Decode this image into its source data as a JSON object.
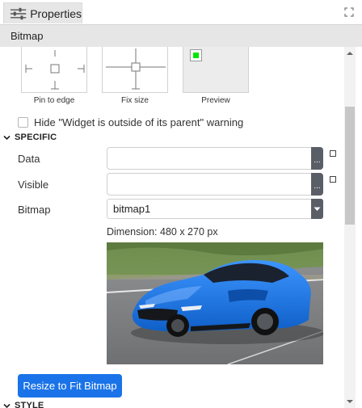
{
  "panel": {
    "tab_title": "Properties",
    "section_title": "Bitmap"
  },
  "anchors": {
    "pin_to_edge": "Pin to edge",
    "fix_size": "Fix size",
    "preview": "Preview",
    "preview_swatch_color": "#00e600"
  },
  "warning_option": {
    "label": "Hide \"Widget is outside of its parent\" warning",
    "checked": false
  },
  "specific": {
    "header": "SPECIFIC",
    "data": {
      "label": "Data",
      "value": "",
      "button": "..."
    },
    "visible": {
      "label": "Visible",
      "value": "",
      "button": "..."
    },
    "bitmap": {
      "label": "Bitmap",
      "selected": "bitmap1"
    },
    "dimension": "Dimension: 480 x 270 px",
    "resize_button": "Resize to Fit Bitmap"
  },
  "style": {
    "header": "STYLE"
  },
  "colors": {
    "accent": "#1a73e8",
    "header_bg": "#e6e6e6",
    "picker_button": "#5a5e66",
    "car_body": "#1f78e6"
  },
  "icons": {
    "tab": "sliders-icon",
    "maximize": "maximize-icon",
    "group_toggle": "chevron-down-icon",
    "dropdown": "caret-down-icon"
  }
}
